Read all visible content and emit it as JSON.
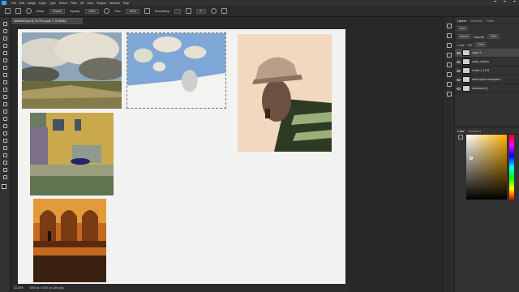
{
  "menubar": {
    "items": [
      "File",
      "Edit",
      "Image",
      "Layer",
      "Type",
      "Select",
      "Filter",
      "3D",
      "View",
      "Plugins",
      "Window",
      "Help"
    ]
  },
  "options": {
    "mode_label": "Mode:",
    "mode_value": "Normal",
    "opacity_label": "Opacity:",
    "opacity_value": "100%",
    "flow_label": "Flow:",
    "flow_value": "100%",
    "smoothing_label": "Smoothing:",
    "smoothing_value": "",
    "angle_value": "0°"
  },
  "document": {
    "tab_title": "artdefault.psd @ 33.3% (Layer 1, RGB/8#) *"
  },
  "status": {
    "zoom": "33.33%",
    "doc_info": "4000 px x 3457 px (300 ppi)"
  },
  "panels": {
    "tabs": [
      "Layers",
      "Channels",
      "Paths"
    ],
    "kind_label": "Kind",
    "blend_mode": "Normal",
    "opacity_label": "Opacity:",
    "opacity_value": "100%",
    "lock_label": "Lock:",
    "fill_label": "Fill:",
    "fill_value": "100%",
    "layers": [
      {
        "name": "Layer 1",
        "selected": true
      },
      {
        "name": "cezar_maluku",
        "selected": false
      },
      {
        "name": "hunter-1-1479",
        "selected": false
      },
      {
        "name": "rafet-rojvisel-clearpath-1",
        "selected": false
      },
      {
        "name": "download (1)",
        "selected": false
      }
    ],
    "color_tabs": [
      "Color",
      "Swatches"
    ]
  },
  "colors": {
    "app_bg": "#282828",
    "panel_bg": "#323232",
    "canvas_bg": "#f2f2f0",
    "accent": "#31a8ff"
  }
}
